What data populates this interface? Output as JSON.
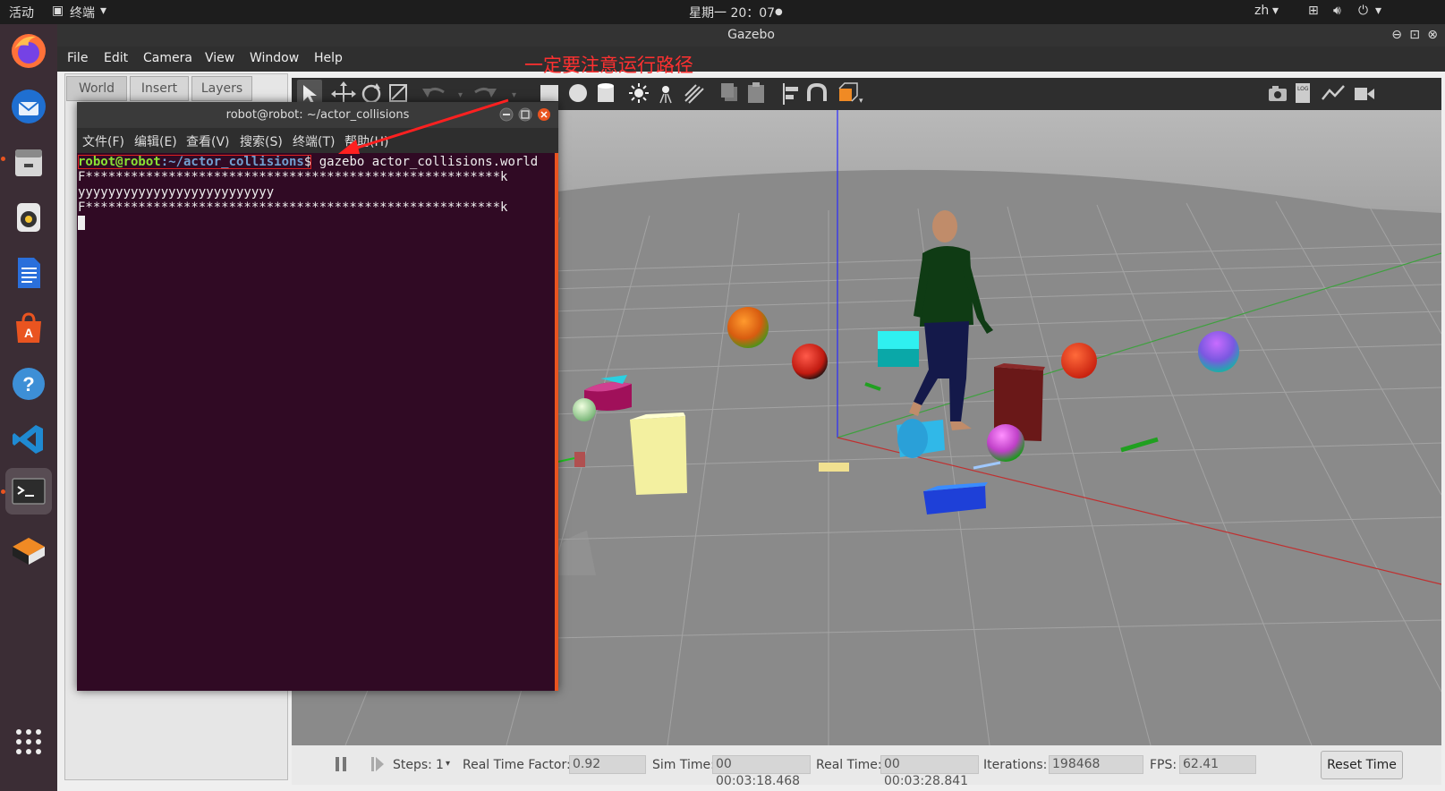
{
  "topbar": {
    "activities": "活动",
    "app_menu": "终端",
    "clock": "星期一 20：07",
    "input_method": "zh"
  },
  "gazebo": {
    "window_title": "Gazebo",
    "menu": [
      "File",
      "Edit",
      "Camera",
      "View",
      "Window",
      "Help"
    ],
    "annotation": "一定要注意运行路径",
    "left_tabs": [
      "World",
      "Insert",
      "Layers"
    ],
    "bottom": {
      "steps_label": "Steps:",
      "steps_value": "1",
      "rtf_label": "Real Time Factor:",
      "rtf_value": "0.92",
      "sim_time_label": "Sim Time:",
      "sim_time_value": "00 00:03:18.468",
      "real_time_label": "Real Time:",
      "real_time_value": "00 00:03:28.841",
      "iterations_label": "Iterations:",
      "iterations_value": "198468",
      "fps_label": "FPS:",
      "fps_value": "62.41",
      "reset_label": "Reset Time"
    }
  },
  "terminal": {
    "title": "robot@robot: ~/actor_collisions",
    "menu": [
      "文件(F)",
      "编辑(E)",
      "查看(V)",
      "搜索(S)",
      "终端(T)",
      "帮助(H)"
    ],
    "prompt_user": "robot@robot",
    "prompt_path": ":~/actor_collisions",
    "prompt_symbol": "$",
    "command": " gazebo actor_collisions.world",
    "output_lines": [
      "F*******************************************************k",
      "yyyyyyyyyyyyyyyyyyyyyyyyyy",
      "F*******************************************************k"
    ]
  },
  "colors": {
    "accent": "#e95420",
    "annotation_red": "#ff3030",
    "terminal_bg": "#300a24"
  },
  "icons": {
    "dock": [
      "firefox-icon",
      "thunderbird-icon",
      "files-icon",
      "rhythmbox-icon",
      "writer-icon",
      "software-center-icon",
      "help-icon",
      "vscode-icon",
      "terminal-icon",
      "gazebo-icon",
      "app-grid-icon"
    ]
  }
}
